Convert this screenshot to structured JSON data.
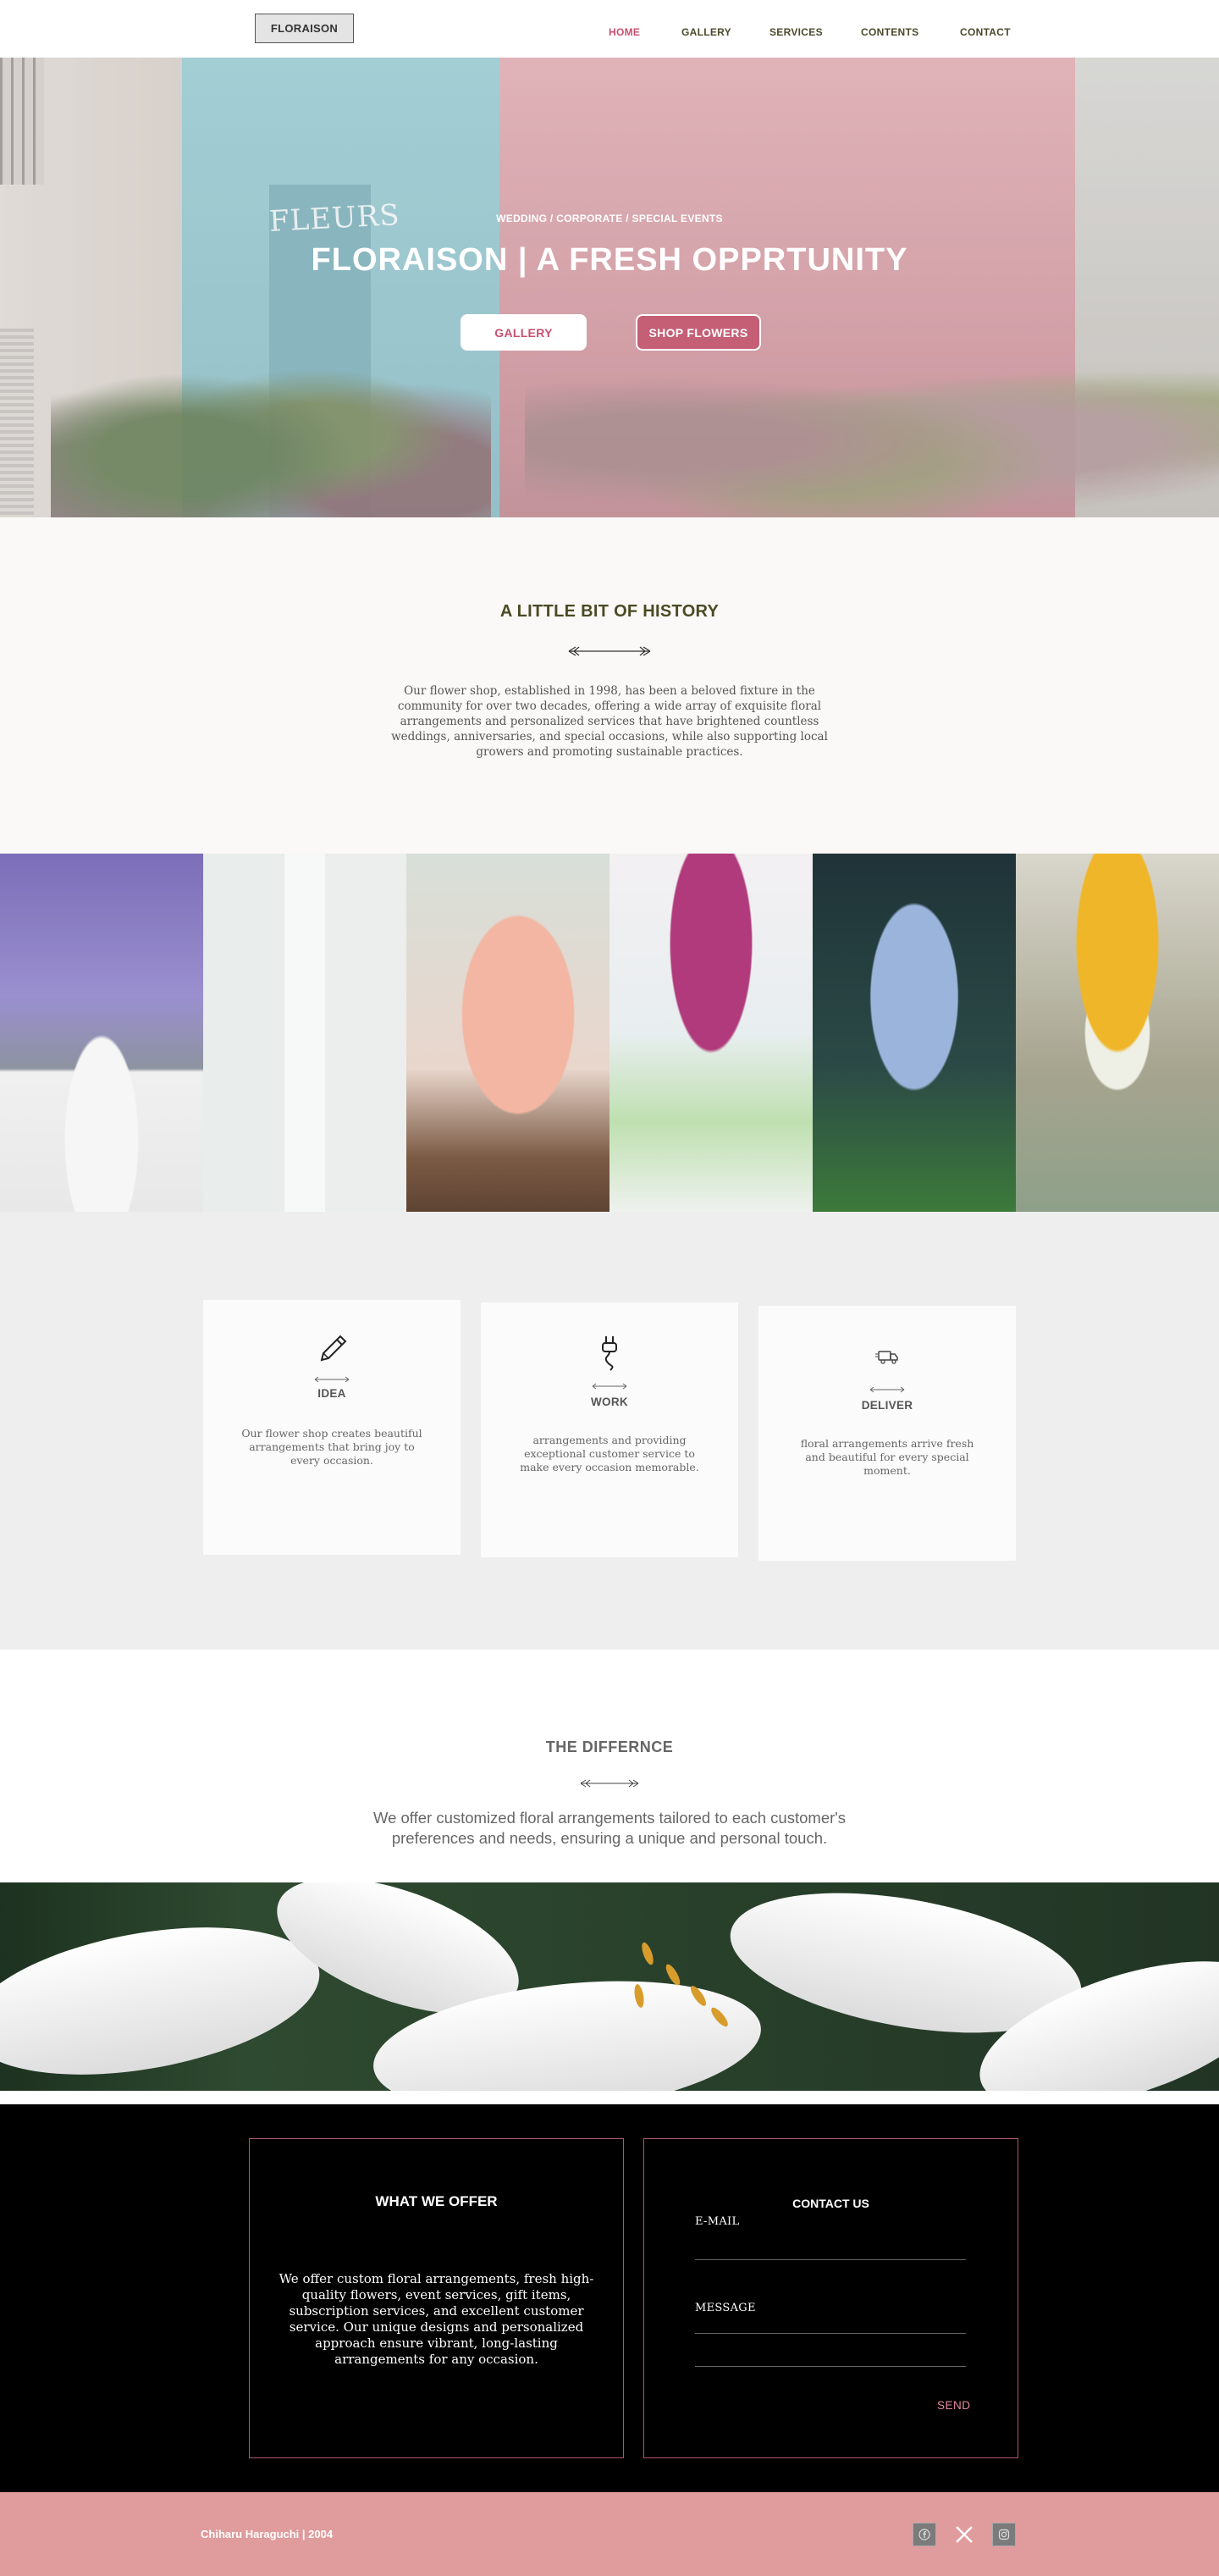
{
  "nav": {
    "logo": "FLORAISON",
    "items": [
      {
        "label": "HOME",
        "active": true
      },
      {
        "label": "GALLERY",
        "active": false
      },
      {
        "label": "SERVICES",
        "active": false
      },
      {
        "label": "CONTENTS",
        "active": false
      },
      {
        "label": "CONTACT",
        "active": false
      }
    ]
  },
  "hero": {
    "tag": "WEDDING / CORPORATE / SPECIAL EVENTS",
    "title": "FLORAISON | A FRESH OPPRTUNITY",
    "sign": "FLEURS",
    "gallery_button": "GALLERY",
    "shop_button": "SHOP FLOWERS"
  },
  "history": {
    "title": "A LITTLE BIT OF HISTORY",
    "text": "Our flower shop, established in 1998, has been a beloved fixture in the community for over two decades, offering a wide array of exquisite floral arrangements and personalized services that have brightened countless weddings, anniversaries, and special occasions, while also supporting local growers and promoting sustainable practices."
  },
  "gallery_strip": [
    "lavender",
    "calla-lily",
    "roses",
    "tulips",
    "lily-of-the-valley",
    "sunflowers"
  ],
  "features": [
    {
      "icon": "pencil-icon",
      "title": "IDEA",
      "text": "Our flower shop creates beautiful arrangements that bring joy to every occasion."
    },
    {
      "icon": "plug-icon",
      "title": "WORK",
      "text": "arrangements and providing exceptional customer service to make every occasion memorable."
    },
    {
      "icon": "truck-icon",
      "title": "DELIVER",
      "text": "floral arrangements arrive fresh and beautiful for every special moment."
    }
  ],
  "difference": {
    "title": "THE DIFFERNCE",
    "text": "We offer customized floral arrangements tailored to each customer's preferences and needs, ensuring a unique and personal touch."
  },
  "offer": {
    "title": "WHAT WE OFFER",
    "text": "We offer custom floral arrangements, fresh high-quality flowers, event services, gift items, subscription services, and excellent customer service. Our unique designs and personalized approach ensure vibrant, long-lasting arrangements for any occasion."
  },
  "contact": {
    "title": "CONTACT US",
    "email_label": "E-MAIL",
    "message_label": "MESSAGE",
    "send": "SEND"
  },
  "footer": {
    "copyright": "Chiharu Haraguchi | 2004",
    "social": [
      "facebook-icon",
      "x-icon",
      "instagram-icon"
    ]
  },
  "colors": {
    "accent_pink": "#c9506f",
    "footer_pink": "#e09b9d",
    "olive": "#4a4a25"
  }
}
